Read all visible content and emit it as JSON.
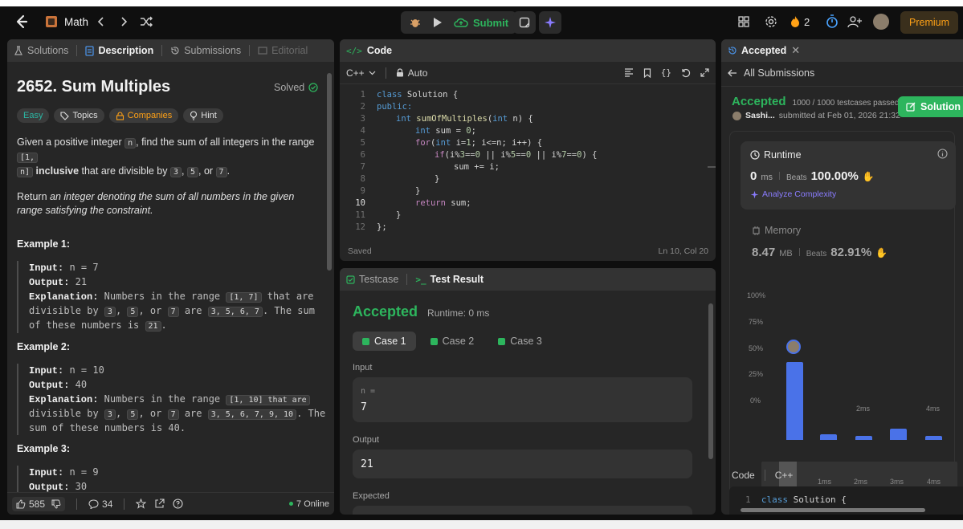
{
  "topbar": {
    "problem_list_label": "Math",
    "submit_label": "Submit",
    "streak_count": "2",
    "premium_label": "Premium"
  },
  "left_panel": {
    "tabs": [
      {
        "label": "Solutions"
      },
      {
        "label": "Description"
      },
      {
        "label": "Submissions"
      },
      {
        "label": "Editorial"
      }
    ],
    "title": "2652. Sum Multiples",
    "solved_label": "Solved",
    "chips": {
      "difficulty": "Easy",
      "topics": "Topics",
      "companies": "Companies",
      "hint": "Hint"
    },
    "desc": {
      "p1_a": "Given a positive integer ",
      "p1_n": "n",
      "p1_b": ", find the sum of all integers in the range ",
      "p1_range_a": "[1,",
      "p1_range_b": "n]",
      "p1_inclusive": "inclusive",
      "p1_c": " that are divisible by ",
      "p1_3": "3",
      "p1_comma1": ", ",
      "p1_5": "5",
      "p1_or": ", or ",
      "p1_7": "7",
      "p1_dot": ".",
      "p2_a": "Return ",
      "p2_b": "an integer denoting the sum of all numbers in the given range satisfying the constraint."
    },
    "examples": [
      {
        "title": "Example 1:",
        "input_label": "Input:",
        "input": " n = 7",
        "output_label": "Output:",
        "output": " 21",
        "expl_label": "Explanation:",
        "expl_a": " Numbers in the range ",
        "range": "[1, 7]",
        "expl_b": " that are",
        "line2_a": "divisible by ",
        "d3": "3",
        "c1": ", ",
        "d5": "5",
        "c2": ", or ",
        "d7": "7",
        "line2_b": " are ",
        "list": "3, 5, 6, 7",
        "line2_c": ". The sum",
        "line3_a": "of these numbers is ",
        "sum": "21",
        "line3_b": "."
      },
      {
        "title": "Example 2:",
        "input_label": "Input:",
        "input": " n = 10",
        "output_label": "Output:",
        "output": " 40",
        "expl_label": "Explanation:",
        "expl_a": " Numbers in the range ",
        "range": "[1, 10] that are",
        "line2_a": "divisible by ",
        "d3": "3",
        "c1": ", ",
        "d5": "5",
        "c2": ", or ",
        "d7": "7",
        "line2_b": " are ",
        "list": "3, 5, 6, 7, 9, 10",
        "line2_c": ". The",
        "line3_a": "sum of these numbers is 40."
      },
      {
        "title": "Example 3:",
        "input_label": "Input:",
        "input": " n = 9",
        "output_label": "Output:",
        "output": " 30"
      }
    ],
    "footer": {
      "likes": "585",
      "comments": "34",
      "online": "7 Online"
    }
  },
  "code_panel": {
    "title": "Code",
    "language": "C++",
    "mode": "Auto",
    "lines": [
      {
        "n": "1"
      },
      {
        "n": "2"
      },
      {
        "n": "3"
      },
      {
        "n": "4"
      },
      {
        "n": "5"
      },
      {
        "n": "6"
      },
      {
        "n": "7"
      },
      {
        "n": "8"
      },
      {
        "n": "9"
      },
      {
        "n": "10"
      },
      {
        "n": "11"
      },
      {
        "n": "12"
      }
    ],
    "code": {
      "l1": [
        "class",
        " Solution {"
      ],
      "l2": [
        "public:"
      ],
      "l3": [
        "int",
        "sumOfMultiples",
        "(",
        "int",
        " n) {"
      ],
      "l4": [
        "int",
        " sum = ",
        "0",
        ";"
      ],
      "l5": [
        "for",
        "(",
        "int",
        " i=",
        "1",
        "; i<=n; i++) {"
      ],
      "l6": [
        "if",
        "(i%",
        "3",
        "==",
        "0",
        " || i%",
        "5",
        "==",
        "0",
        " || i%",
        "7",
        "==",
        "0",
        ") {"
      ],
      "l7": [
        "sum += i;"
      ],
      "l8": [
        "}"
      ],
      "l9": [
        "}"
      ],
      "l10": [
        "return",
        " sum;"
      ],
      "l11": [
        "}"
      ],
      "l12": [
        "};"
      ]
    },
    "status": "Saved",
    "cursor": "Ln 10, Col 20"
  },
  "test_panel": {
    "tab_testcase": "Testcase",
    "tab_result": "Test Result",
    "verdict": "Accepted",
    "runtime": "Runtime: 0 ms",
    "cases": [
      "Case 1",
      "Case 2",
      "Case 3"
    ],
    "input_label": "Input",
    "input_var": "n =",
    "input_value": "7",
    "output_label": "Output",
    "output_value": "21",
    "expected_label": "Expected"
  },
  "result_panel": {
    "tab_label": "Accepted",
    "back_label": "All Submissions",
    "verdict": "Accepted",
    "testcases": "1000 / 1000 testcases passed",
    "user": "Sashi...",
    "submitted": "submitted at Feb 01, 2026 21:32",
    "solution_button": "Solution",
    "runtime_label": "Runtime",
    "runtime_value": "0",
    "runtime_unit": "ms",
    "beats_label": "Beats",
    "runtime_beats": "100.00%",
    "analyze_label": "Analyze Complexity",
    "memory_label": "Memory",
    "memory_value": "8.47",
    "memory_unit": "MB",
    "memory_beats": "82.91%",
    "code_label": "Code",
    "code_lang": "C++",
    "code_line_no": "1",
    "code_kw": "class",
    "code_rest": " Solution {"
  },
  "chart_data": {
    "type": "bar",
    "y_ticks": [
      "100%",
      "75%",
      "50%",
      "25%",
      "0%"
    ],
    "x_ticks": [
      "2ms",
      "4ms"
    ],
    "mini_ticks": [
      "1ms",
      "2ms",
      "3ms",
      "4ms"
    ],
    "values": [
      74,
      5,
      4,
      11,
      4
    ],
    "ylim": [
      0,
      100
    ]
  },
  "colors": {
    "accent_green": "#2db55d",
    "bar_blue": "#4a72e8",
    "premium": "#ffa116"
  }
}
